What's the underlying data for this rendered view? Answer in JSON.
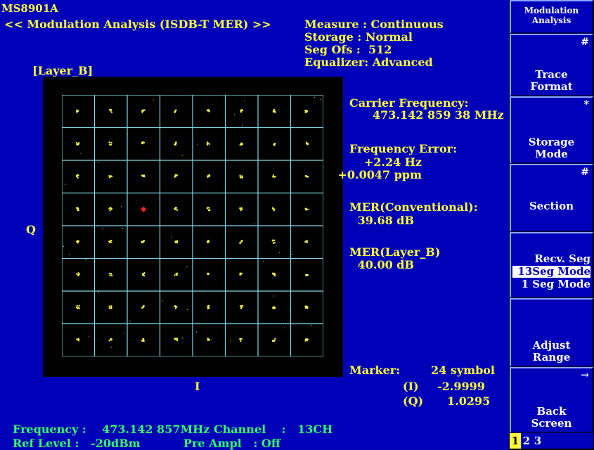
{
  "header": {
    "model": "MS8901A",
    "title": "<< Modulation Analysis (ISDB-T MER) >>",
    "layer_label": "[Layer_B]"
  },
  "settings": {
    "measure": "Measure : Continuous",
    "storage": "Storage : Normal",
    "seg_ofs": "Seg Ofs :  512",
    "equalizer": "Equalizer: Advanced"
  },
  "results": {
    "carrier_freq_label": "Carrier Frequency:",
    "carrier_freq_value": "473.142 859 38 MHz",
    "freq_error_label": "Frequency Error:",
    "freq_error_hz": "+2.24 Hz",
    "freq_error_ppm": "+0.0047 ppm",
    "mer_conv_label": "MER(Conventional):",
    "mer_conv_value": "39.68 dB",
    "mer_layer_label": "MER(Layer_B)",
    "mer_layer_value": "40.00 dB"
  },
  "marker": {
    "label": "Marker:",
    "symbol": "24 symbol",
    "i_label": "(I)",
    "i_value": "-2.9999",
    "q_label": "(Q)",
    "q_value": "1.0295"
  },
  "axes": {
    "q": "Q",
    "i": "I"
  },
  "footer": {
    "frequency": "Frequency :    473.142 857MHz Channel    :   13CH",
    "ref_level": "Ref Level :   -20dBm           Pre Ampl   : Off"
  },
  "constellation": {
    "grid_size": 8,
    "marker_point": [
      2,
      3
    ],
    "point_color": "#ffff3a",
    "marker_color": "#ff2020"
  },
  "softkeys": {
    "menu_title_1": "Modulation",
    "menu_title_2": "Analysis",
    "trace_format_mark": "#",
    "trace_format_1": "Trace",
    "trace_format_2": "Format",
    "storage_mode_mark": "*",
    "storage_mode_1": "Storage",
    "storage_mode_2": "Mode",
    "section_mark": "#",
    "section": "Section",
    "recv_seg": "Recv. Seg",
    "recv_13seg": "13Seg Mode",
    "recv_1seg": "1 Seg Mode",
    "adjust_range_1": "Adjust",
    "adjust_range_2": "Range",
    "back_mark": "→",
    "back_1": "Back",
    "back_2": "Screen",
    "pages": [
      "1",
      "2",
      "3"
    ]
  },
  "colors": {
    "background": "#0000b8",
    "text_primary": "#ffff3a",
    "text_footer": "#33ff66",
    "grid_line": "#7fd8e8"
  }
}
